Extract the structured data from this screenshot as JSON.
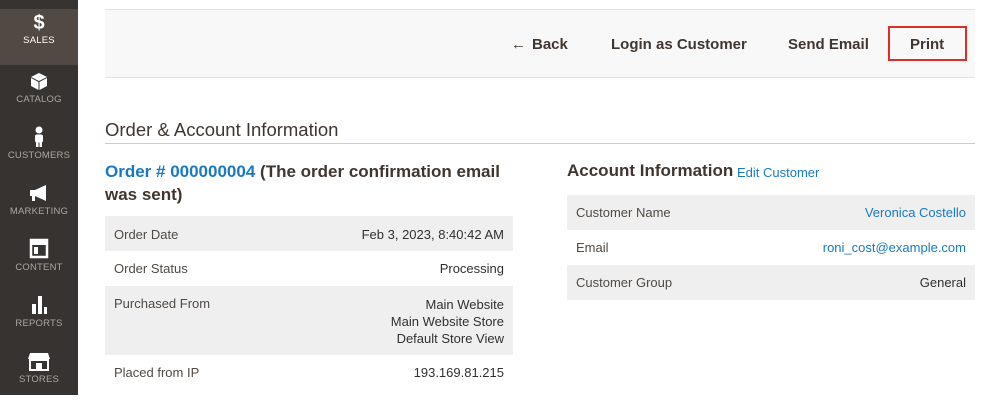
{
  "sidebar": {
    "items": [
      {
        "label": "SALES",
        "icon": "dollar-icon"
      },
      {
        "label": "CATALOG",
        "icon": "cube-icon"
      },
      {
        "label": "CUSTOMERS",
        "icon": "person-icon"
      },
      {
        "label": "MARKETING",
        "icon": "megaphone-icon"
      },
      {
        "label": "CONTENT",
        "icon": "layout-icon"
      },
      {
        "label": "REPORTS",
        "icon": "bar-chart-icon"
      },
      {
        "label": "STORES",
        "icon": "storefront-icon"
      }
    ],
    "active_color": "#514943",
    "background": "#373330"
  },
  "toolbar": {
    "back_label": "Back",
    "login_label": "Login as Customer",
    "email_label": "Send Email",
    "print_label": "Print",
    "highlight_color": "#e02b27"
  },
  "section": {
    "title": "Order & Account Information"
  },
  "order": {
    "link_text": "Order # 000000004",
    "note_text": "(The order confirmation email was sent)",
    "rows": [
      {
        "label": "Order Date",
        "value": "Feb 3, 2023, 8:40:42 AM"
      },
      {
        "label": "Order Status",
        "value": "Processing"
      },
      {
        "label": "Purchased From",
        "value_lines": [
          "Main Website",
          "Main Website Store",
          "Default Store View"
        ]
      },
      {
        "label": "Placed from IP",
        "value": "193.169.81.215"
      }
    ]
  },
  "account": {
    "title": "Account Information",
    "edit_label": "Edit Customer",
    "rows": [
      {
        "label": "Customer Name",
        "value": "Veronica Costello"
      },
      {
        "label": "Email",
        "value": "roni_cost@example.com"
      },
      {
        "label": "Customer Group",
        "value": "General"
      }
    ]
  },
  "colors": {
    "link": "#1979c3",
    "heading": "#41362f"
  }
}
